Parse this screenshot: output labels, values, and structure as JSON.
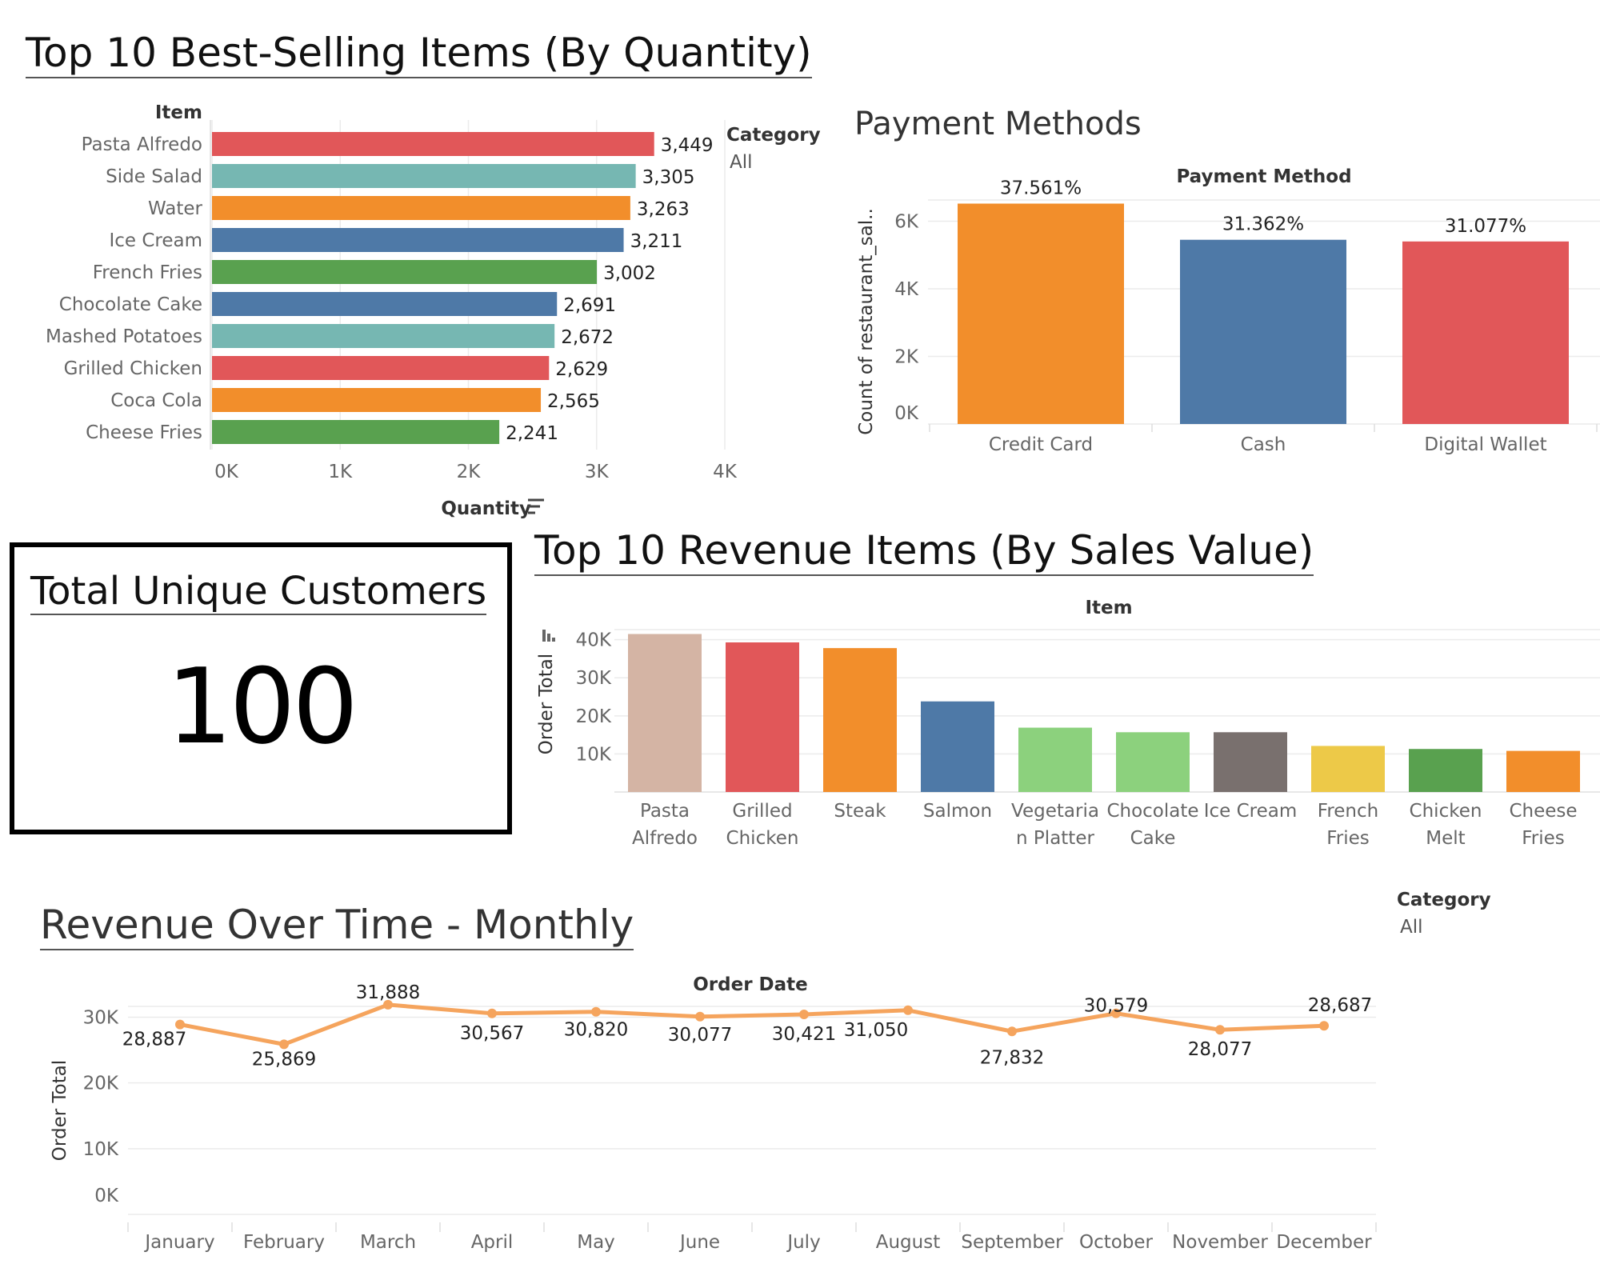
{
  "colors": {
    "red": "#e15759",
    "teal": "#76b7b2",
    "orange": "#f28e2b",
    "blue": "#4e79a7",
    "green": "#59a14f",
    "tan": "#d4b4a4",
    "lightgreen": "#8cd17d",
    "gray": "#79706e",
    "yellow": "#edc948",
    "line_orange": "#f5a45d"
  },
  "qty_chart": {
    "title": "Top 10 Best-Selling Items (By Quantity)",
    "item_header": "Item",
    "xlabel": "Quantity",
    "sort_icon": "sort-descending-icon",
    "filter_label": "Category",
    "filter_value": "All"
  },
  "payment_chart": {
    "title": "Payment Methods",
    "header": "Payment Method",
    "ylabel": "Count of restaurant_sal.."
  },
  "kpi": {
    "title": "Total Unique Customers",
    "value": "100"
  },
  "revenue_items_chart": {
    "title": "Top 10 Revenue Items (By Sales Value)",
    "header": "Item",
    "ylabel": "Order Total",
    "sort_icon": "sort-bars-icon"
  },
  "monthly_chart": {
    "title": "Revenue Over Time - Monthly",
    "header": "Order Date",
    "ylabel": "Order Total",
    "filter_label": "Category",
    "filter_value": "All"
  },
  "chart_data": [
    {
      "type": "bar",
      "orientation": "horizontal",
      "title": "Top 10 Best-Selling Items (By Quantity)",
      "xlabel": "Quantity",
      "ylabel": "Item",
      "categories": [
        "Pasta Alfredo",
        "Side Salad",
        "Water",
        "Ice Cream",
        "French Fries",
        "Chocolate Cake",
        "Mashed Potatoes",
        "Grilled Chicken",
        "Coca Cola",
        "Cheese Fries"
      ],
      "values": [
        3449,
        3305,
        3263,
        3211,
        3002,
        2691,
        2672,
        2629,
        2565,
        2241
      ],
      "value_labels": [
        "3,449",
        "3,305",
        "3,263",
        "3,211",
        "3,002",
        "2,691",
        "2,672",
        "2,629",
        "2,565",
        "2,241"
      ],
      "bar_colors": [
        "#e15759",
        "#76b7b2",
        "#f28e2b",
        "#4e79a7",
        "#59a14f",
        "#4e79a7",
        "#76b7b2",
        "#e15759",
        "#f28e2b",
        "#59a14f"
      ],
      "xlim": [
        0,
        4000
      ],
      "xticks": [
        0,
        1000,
        2000,
        3000,
        4000
      ],
      "xtick_labels": [
        "0K",
        "1K",
        "2K",
        "3K",
        "4K"
      ],
      "grid": true
    },
    {
      "type": "bar",
      "title": "Payment Methods",
      "xlabel": "Payment Method",
      "ylabel": "Count of restaurant_sal..",
      "categories": [
        "Credit Card",
        "Cash",
        "Digital Wallet"
      ],
      "values": [
        6520,
        5450,
        5400
      ],
      "value_labels": [
        "37.561%",
        "31.362%",
        "31.077%"
      ],
      "bar_colors": [
        "#f28e2b",
        "#4e79a7",
        "#e15759"
      ],
      "ylim": [
        0,
        7100
      ],
      "yticks": [
        0,
        2000,
        4000,
        6000
      ],
      "ytick_labels": [
        "0K",
        "2K",
        "4K",
        "6K"
      ],
      "grid": true
    },
    {
      "type": "bar",
      "title": "Top 10 Revenue Items (By Sales Value)",
      "xlabel": "Item",
      "ylabel": "Order Total",
      "categories": [
        [
          "Pasta",
          "Alfredo"
        ],
        [
          "Grilled",
          "Chicken"
        ],
        [
          "Steak"
        ],
        [
          "Salmon"
        ],
        [
          "Vegetaria",
          "n Platter"
        ],
        [
          "Chocolate",
          "Cake"
        ],
        [
          "Ice Cream"
        ],
        [
          "French",
          "Fries"
        ],
        [
          "Chicken",
          "Melt"
        ],
        [
          "Cheese",
          "Fries"
        ]
      ],
      "values": [
        41500,
        39300,
        37800,
        23800,
        16900,
        15700,
        15700,
        12100,
        11300,
        10800
      ],
      "bar_colors": [
        "#d4b4a4",
        "#e15759",
        "#f28e2b",
        "#4e79a7",
        "#8cd17d",
        "#8cd17d",
        "#79706e",
        "#edc948",
        "#59a14f",
        "#f28e2b"
      ],
      "ylim": [
        0,
        43500
      ],
      "yticks": [
        10000,
        20000,
        30000,
        40000
      ],
      "ytick_labels": [
        "10K",
        "20K",
        "30K",
        "40K"
      ],
      "grid": true
    },
    {
      "type": "line",
      "title": "Revenue Over Time - Monthly",
      "xlabel": "Order Date",
      "ylabel": "Order Total",
      "x": [
        "January",
        "February",
        "March",
        "April",
        "May",
        "June",
        "July",
        "August",
        "September",
        "October",
        "November",
        "December"
      ],
      "values": [
        28887,
        25869,
        31888,
        30567,
        30820,
        30077,
        30421,
        31050,
        27832,
        30579,
        28077,
        28687
      ],
      "value_labels": [
        "28,887",
        "25,869",
        "31,888",
        "30,567",
        "30,820",
        "30,077",
        "30,421",
        "31,050",
        "27,832",
        "30,579",
        "28,077",
        "28,687"
      ],
      "color": "#f5a45d",
      "ylim": [
        0,
        32000
      ],
      "yticks": [
        0,
        10000,
        20000,
        30000
      ],
      "ytick_labels": [
        "0K",
        "10K",
        "20K",
        "30K"
      ],
      "grid": true
    }
  ]
}
